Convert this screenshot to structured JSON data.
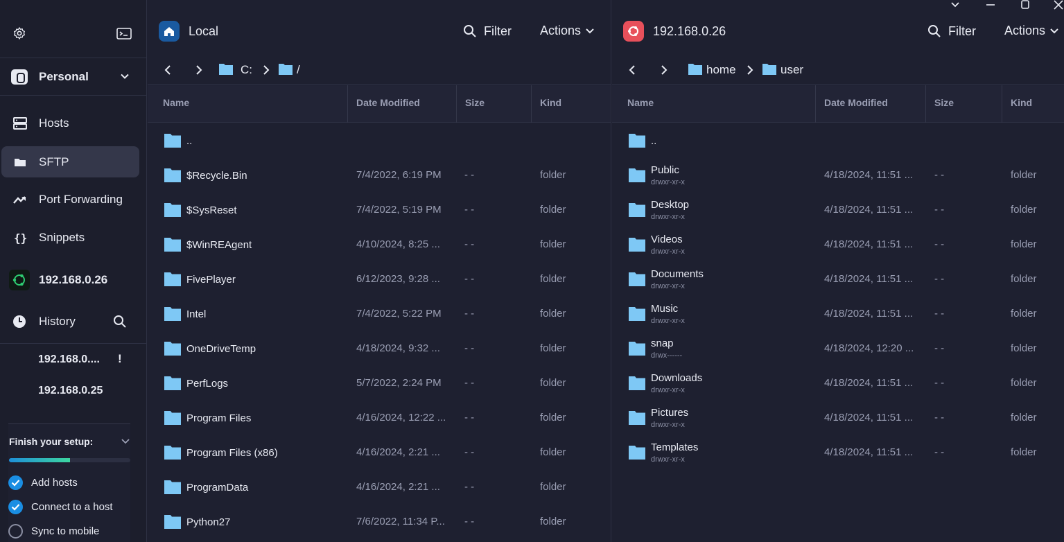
{
  "sidebar": {
    "vault_label": "Personal",
    "nav": [
      {
        "label": "Hosts",
        "icon": "hosts-icon"
      },
      {
        "label": "SFTP",
        "icon": "folder-icon",
        "active": true
      },
      {
        "label": "Port Forwarding",
        "icon": "port-forwarding-icon"
      },
      {
        "label": "Snippets",
        "icon": "snippets-icon"
      }
    ],
    "connected_host": "192.168.0.26",
    "history_label": "History",
    "history_entries": [
      "192.168.0....",
      "192.168.0.25"
    ],
    "history_warning": "!",
    "setup": {
      "title": "Finish your setup:",
      "progress": 0.5,
      "tasks": [
        {
          "label": "Add hosts",
          "done": true
        },
        {
          "label": "Connect to a host",
          "done": true
        },
        {
          "label": "Sync to mobile",
          "done": false
        }
      ]
    }
  },
  "left_panel": {
    "title": "Local",
    "filter_label": "Filter",
    "actions_label": "Actions",
    "breadcrumb": [
      "C:",
      "/"
    ],
    "columns": [
      "Name",
      "Date Modified",
      "Size",
      "Kind"
    ],
    "rows": [
      {
        "name": "..",
        "date": "",
        "size": "",
        "kind": ""
      },
      {
        "name": "$Recycle.Bin",
        "date": "7/4/2022, 6:19 PM",
        "size": "- -",
        "kind": "folder"
      },
      {
        "name": "$SysReset",
        "date": "7/4/2022, 5:19 PM",
        "size": "- -",
        "kind": "folder"
      },
      {
        "name": "$WinREAgent",
        "date": "4/10/2024, 8:25 ...",
        "size": "- -",
        "kind": "folder"
      },
      {
        "name": "FivePlayer",
        "date": "6/12/2023, 9:28 ...",
        "size": "- -",
        "kind": "folder"
      },
      {
        "name": "Intel",
        "date": "7/4/2022, 5:22 PM",
        "size": "- -",
        "kind": "folder"
      },
      {
        "name": "OneDriveTemp",
        "date": "4/18/2024, 9:32 ...",
        "size": "- -",
        "kind": "folder"
      },
      {
        "name": "PerfLogs",
        "date": "5/7/2022, 2:24 PM",
        "size": "- -",
        "kind": "folder"
      },
      {
        "name": "Program Files",
        "date": "4/16/2024, 12:22 ...",
        "size": "- -",
        "kind": "folder"
      },
      {
        "name": "Program Files (x86)",
        "date": "4/16/2024, 2:21 ...",
        "size": "- -",
        "kind": "folder"
      },
      {
        "name": "ProgramData",
        "date": "4/16/2024, 2:21 ...",
        "size": "- -",
        "kind": "folder"
      },
      {
        "name": "Python27",
        "date": "7/6/2022, 11:34 P...",
        "size": "- -",
        "kind": "folder"
      }
    ]
  },
  "right_panel": {
    "title": "192.168.0.26",
    "filter_label": "Filter",
    "actions_label": "Actions",
    "breadcrumb": [
      "home",
      "user"
    ],
    "columns": [
      "Name",
      "Date Modified",
      "Size",
      "Kind"
    ],
    "rows": [
      {
        "name": "..",
        "perm": "",
        "date": "",
        "size": "",
        "kind": ""
      },
      {
        "name": "Public",
        "perm": "drwxr-xr-x",
        "date": "4/18/2024, 11:51 ...",
        "size": "- -",
        "kind": "folder"
      },
      {
        "name": "Desktop",
        "perm": "drwxr-xr-x",
        "date": "4/18/2024, 11:51 ...",
        "size": "- -",
        "kind": "folder"
      },
      {
        "name": "Videos",
        "perm": "drwxr-xr-x",
        "date": "4/18/2024, 11:51 ...",
        "size": "- -",
        "kind": "folder"
      },
      {
        "name": "Documents",
        "perm": "drwxr-xr-x",
        "date": "4/18/2024, 11:51 ...",
        "size": "- -",
        "kind": "folder"
      },
      {
        "name": "Music",
        "perm": "drwxr-xr-x",
        "date": "4/18/2024, 11:51 ...",
        "size": "- -",
        "kind": "folder"
      },
      {
        "name": "snap",
        "perm": "drwx------",
        "date": "4/18/2024, 12:20 ...",
        "size": "- -",
        "kind": "folder"
      },
      {
        "name": "Downloads",
        "perm": "drwxr-xr-x",
        "date": "4/18/2024, 11:51 ...",
        "size": "- -",
        "kind": "folder"
      },
      {
        "name": "Pictures",
        "perm": "drwxr-xr-x",
        "date": "4/18/2024, 11:51 ...",
        "size": "- -",
        "kind": "folder"
      },
      {
        "name": "Templates",
        "perm": "drwxr-xr-x",
        "date": "4/18/2024, 11:51 ...",
        "size": "- -",
        "kind": "folder"
      }
    ]
  },
  "colors": {
    "background": "#1e2030",
    "sidebar": "#1c1e2c",
    "folder": "#7ec8f5",
    "local_badge": "#1a5aa0",
    "remote_badge": "#e8505b",
    "accent": "#1a8ee3"
  }
}
